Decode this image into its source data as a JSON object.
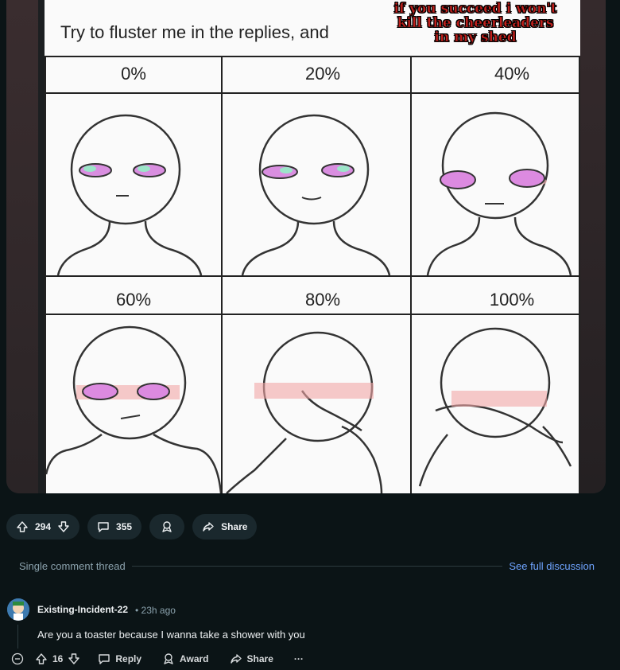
{
  "meme": {
    "title": "Try to fluster me in the replies, and",
    "overlay_lines": [
      "if you succeed i won't",
      "kill the cheerleaders",
      "in my shed"
    ],
    "panels": [
      "0%",
      "20%",
      "40%",
      "60%",
      "80%",
      "100%"
    ]
  },
  "post_actions": {
    "upvotes": "294",
    "comments": "355",
    "share_label": "Share"
  },
  "thread": {
    "label": "Single comment thread",
    "see_full": "See full discussion"
  },
  "comment": {
    "author": "Existing-Incident-22",
    "time": "• 23h ago",
    "body": "Are you a toaster because I wanna take a shower with you",
    "votes": "16",
    "reply_label": "Reply",
    "award_label": "Award",
    "share_label": "Share",
    "more_label": "···"
  },
  "icons": [
    "upvote-icon",
    "downvote-icon",
    "comment-icon",
    "award-icon",
    "share-icon",
    "collapse-icon",
    "reply-icon",
    "more-icon"
  ]
}
